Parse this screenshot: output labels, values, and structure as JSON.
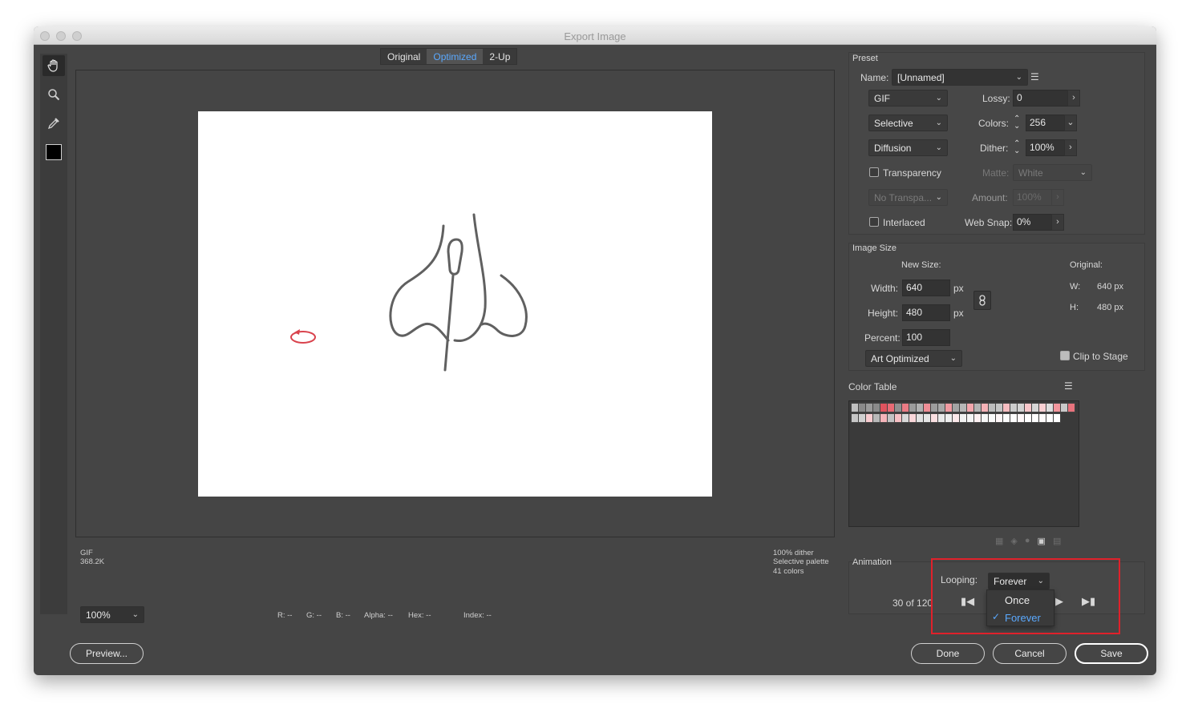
{
  "window": {
    "title": "Export Image"
  },
  "view_tabs": [
    {
      "label": "Original",
      "active": false
    },
    {
      "label": "Optimized",
      "active": true
    },
    {
      "label": "2-Up",
      "active": false
    }
  ],
  "tools": [
    "hand-icon",
    "zoom-icon",
    "eyedropper-icon",
    "color-swatch"
  ],
  "status_left": {
    "format": "GIF",
    "size": "368.2K"
  },
  "status_right": {
    "line1": "100% dither",
    "line2": "Selective palette",
    "line3": "41 colors"
  },
  "zoom": {
    "value": "100%"
  },
  "pixel_info": {
    "r": "R: --",
    "g": "G: --",
    "b": "B: --",
    "alpha": "Alpha: --",
    "hex": "Hex: --",
    "index": "Index: --"
  },
  "buttons": {
    "preview": "Preview...",
    "done": "Done",
    "cancel": "Cancel",
    "save": "Save"
  },
  "preset": {
    "heading": "Preset",
    "name_label": "Name:",
    "name_value": "[Unnamed]",
    "format": "GIF",
    "reduction": "Selective",
    "dither_algo": "Diffusion",
    "transparency_dither": "No Transpa...",
    "lossy_label": "Lossy:",
    "lossy_value": "0",
    "colors_label": "Colors:",
    "colors_value": "256",
    "dither_label": "Dither:",
    "dither_value": "100%",
    "transparency_label": "Transparency",
    "transparency_checked": false,
    "matte_label": "Matte:",
    "matte_value": "White",
    "amount_label": "Amount:",
    "amount_value": "100%",
    "interlaced_label": "Interlaced",
    "interlaced_checked": false,
    "websnap_label": "Web Snap:",
    "websnap_value": "0%"
  },
  "image_size": {
    "heading": "Image Size",
    "new_size_label": "New Size:",
    "original_label": "Original:",
    "width_label": "Width:",
    "width_value": "640",
    "width_unit": "px",
    "height_label": "Height:",
    "height_value": "480",
    "height_unit": "px",
    "percent_label": "Percent:",
    "percent_value": "100",
    "resample": "Art Optimized",
    "orig_w_label": "W:",
    "orig_w_value": "640 px",
    "orig_h_label": "H:",
    "orig_h_value": "480 px",
    "clip_label": "Clip to Stage",
    "clip_checked": true
  },
  "color_table": {
    "heading": "Color Table",
    "row1": [
      "#bfbfbf",
      "#8a8a8a",
      "#9a9a9a",
      "#8a8a8a",
      "#e0535e",
      "#e86a74",
      "#8f8f8f",
      "#ea7b84",
      "#9b9b9b",
      "#b0b0b0",
      "#ee8d95",
      "#9d9d9d",
      "#a8a8a8",
      "#f09aa1",
      "#a3a3a3",
      "#b6b6b6",
      "#f2a6ac",
      "#b3b3b3",
      "#f4b1b6",
      "#bcbcbc",
      "#c4c4c4",
      "#f5bcc0",
      "#cccccc",
      "#d2d2d2",
      "#f7c6ca",
      "#d6d6d6",
      "#f9d0d3",
      "#dddddd",
      "#f2959c",
      "#c9c9c9",
      "#e8737d"
    ],
    "row2": [
      "#c7c7c7",
      "#d0d0d0",
      "#f8ccd0",
      "#b8b8b8",
      "#f4b4b9",
      "#c2c2c2",
      "#f6c0c4",
      "#d9d9d9",
      "#fad7da",
      "#e2e2e2",
      "#e6e6e6",
      "#fbe0e2",
      "#e9e9e9",
      "#eeeeee",
      "#fce8ea",
      "#f1f1f1",
      "#f4f4f4",
      "#fdf0f1",
      "#f7f7f7",
      "#fafafa",
      "#fdf6f7",
      "#fcfcfc",
      "#fefefe",
      "#fff8f9",
      "#ffffff",
      "#ffffff",
      "#fefbfb",
      "#ffffff",
      "#ffffff"
    ]
  },
  "animation": {
    "heading": "Animation",
    "looping_label": "Looping:",
    "looping_value": "Forever",
    "frame_info": "30 of 120",
    "options": [
      {
        "label": "Once",
        "selected": false
      },
      {
        "label": "Forever",
        "selected": true
      }
    ]
  },
  "colors": {
    "accent": "#5aa9ff",
    "highlight": "#e0212b",
    "stroke": "#606060",
    "rotate_icon": "#d9434d"
  }
}
